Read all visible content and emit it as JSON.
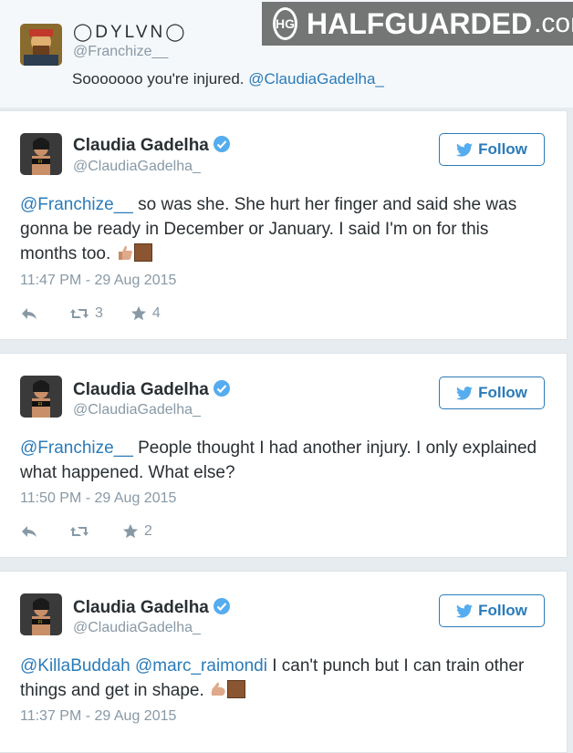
{
  "header_tweet": {
    "display_name": "◯DYLVN◯",
    "handle": "@Franchize__",
    "text_prefix": "Sooooooo you're injured. ",
    "mention": "@ClaudiaGadelha_"
  },
  "watermark": {
    "badge": "HG",
    "brand": "HALFGUARDED",
    "domain": ".com"
  },
  "follow_label": "Follow",
  "tweets": [
    {
      "name": "Claudia Gadelha",
      "handle": "@ClaudiaGadelha_",
      "mention1": "@Franchize__",
      "body1": " so was she. She hurt her finger and said she was gonna be ready in December or January. I said I'm on for this months too.",
      "timestamp": "11:47 PM - 29 Aug 2015",
      "retweets": "3",
      "favorites": "4"
    },
    {
      "name": "Claudia Gadelha",
      "handle": "@ClaudiaGadelha_",
      "mention1": "@Franchize__",
      "body1": " People thought I had another injury. I only explained what happened. What else?",
      "timestamp": "11:50 PM - 29 Aug 2015",
      "retweets": "",
      "favorites": "2"
    },
    {
      "name": "Claudia Gadelha",
      "handle": "@ClaudiaGadelha_",
      "mention1": "@KillaBuddah",
      "mention2": "@marc_raimondi",
      "body1": " I can't punch but I can train other things and get in shape.",
      "timestamp": "11:37 PM - 29 Aug 2015"
    }
  ],
  "colors": {
    "link": "#2b7bb9",
    "muted": "#8899a6",
    "text": "#292f33"
  }
}
